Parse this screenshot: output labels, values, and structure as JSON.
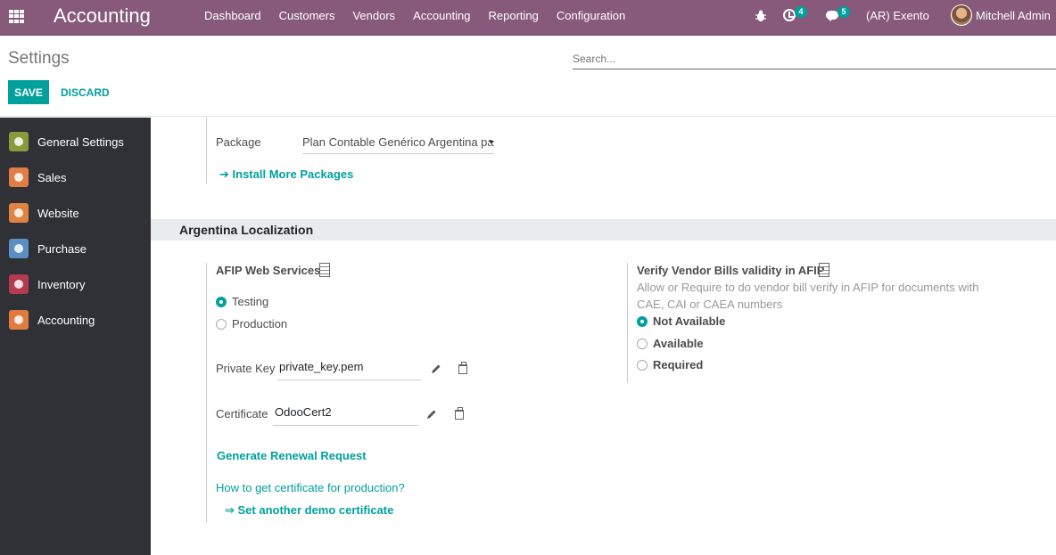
{
  "navbar": {
    "brand": "Accounting",
    "menu": [
      "Dashboard",
      "Customers",
      "Vendors",
      "Accounting",
      "Reporting",
      "Configuration"
    ],
    "activity_count": "4",
    "message_count": "5",
    "company": "(AR) Exento",
    "user": "Mitchell Admin",
    "colors": {
      "bar": "#875a7b",
      "badge": "#00a09d"
    }
  },
  "control_panel": {
    "title": "Settings",
    "search_placeholder": "Search...",
    "save_label": "SAVE",
    "discard_label": "DISCARD"
  },
  "sidebar": {
    "items": [
      {
        "label": "General Settings",
        "icon": "gear-icon",
        "color": "#8a9a3a"
      },
      {
        "label": "Sales",
        "icon": "chart-icon",
        "color": "#e17c43"
      },
      {
        "label": "Website",
        "icon": "globe-icon",
        "color": "#e0853f"
      },
      {
        "label": "Purchase",
        "icon": "card-icon",
        "color": "#5b8ec3"
      },
      {
        "label": "Inventory",
        "icon": "box-icon",
        "color": "#b33a4f"
      },
      {
        "label": "Accounting",
        "icon": "dollar-doc-icon",
        "color": "#e07b3f"
      }
    ]
  },
  "fiscal": {
    "package_label": "Package",
    "package_value": "Plan Contable Genérico Argentina para",
    "install_link": "Install More Packages"
  },
  "localization": {
    "section_title": "Argentina Localization",
    "afip": {
      "title": "AFIP Web Services",
      "options": [
        "Testing",
        "Production"
      ],
      "selected": "Testing",
      "private_key_label": "Private Key",
      "private_key_value": "private_key.pem",
      "certificate_label": "Certificate",
      "certificate_value": "OdooCert2",
      "renewal_link": "Generate Renewal Request",
      "howto_link": "How to get certificate for production?",
      "demo_link": "⇒ Set another demo certificate"
    },
    "verify": {
      "title": "Verify Vendor Bills validity in AFIP",
      "help": "Allow or Require to do vendor bill verify in AFIP for documents with CAE, CAI or CAEA numbers",
      "options": [
        "Not Available",
        "Available",
        "Required"
      ],
      "selected": "Not Available"
    }
  }
}
